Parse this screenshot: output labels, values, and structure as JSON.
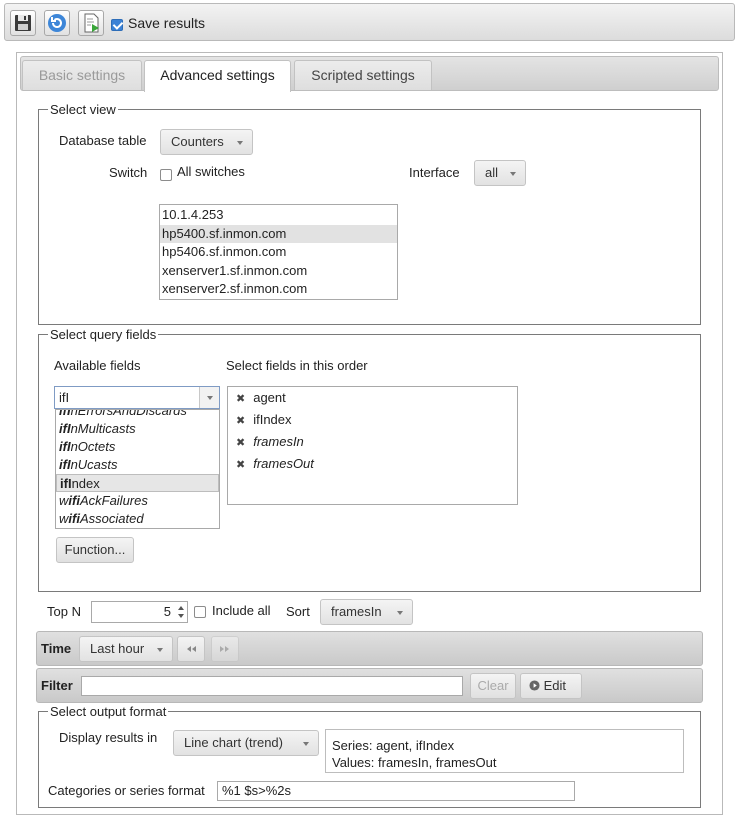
{
  "toolbar": {
    "save_icon": "floppy-disk-icon",
    "refresh_icon": "refresh-icon",
    "run_icon": "run-document-icon",
    "save_results_label": "Save results",
    "save_results_checked": true
  },
  "tabs": [
    {
      "label": "Basic settings",
      "active": false
    },
    {
      "label": "Advanced settings",
      "active": true
    },
    {
      "label": "Scripted settings",
      "active": false
    }
  ],
  "select_view": {
    "legend": "Select view",
    "database_table_label": "Database table",
    "database_table_value": "Counters",
    "switch_label": "Switch",
    "all_switches_label": "All switches",
    "interface_label": "Interface",
    "interface_value": "all",
    "switches": [
      "10.1.4.253",
      "hp5400.sf.inmon.com",
      "hp5406.sf.inmon.com",
      "xenserver1.sf.inmon.com",
      "xenserver2.sf.inmon.com"
    ],
    "selected_switch_index": 1
  },
  "query_fields": {
    "legend": "Select query fields",
    "available_label": "Available fields",
    "order_label": "Select fields in this order",
    "filter_value": "ifI",
    "available": [
      {
        "prefix": "",
        "match": "ifI",
        "suffix": "nErrorsAndDiscards"
      },
      {
        "prefix": "",
        "match": "ifI",
        "suffix": "nMulticasts"
      },
      {
        "prefix": "",
        "match": "ifI",
        "suffix": "nOctets"
      },
      {
        "prefix": "",
        "match": "ifI",
        "suffix": "nUcasts"
      },
      {
        "prefix": "",
        "match": "ifI",
        "suffix": "ndex"
      },
      {
        "prefix": "w",
        "match": "ifi",
        "suffix": "AckFailures"
      },
      {
        "prefix": "w",
        "match": "ifi",
        "suffix": "Associated"
      }
    ],
    "available_selected_index": 4,
    "selected": [
      {
        "name": "agent",
        "italic": false
      },
      {
        "name": "ifIndex",
        "italic": false
      },
      {
        "name": "framesIn",
        "italic": true
      },
      {
        "name": "framesOut",
        "italic": true
      }
    ],
    "function_button": "Function..."
  },
  "topn": {
    "label": "Top N",
    "value": "5",
    "include_all_label": "Include all",
    "sort_label": "Sort",
    "sort_value": "framesIn"
  },
  "time": {
    "label": "Time",
    "value": "Last hour",
    "prev_icon": "rewind-icon",
    "next_icon": "fast-forward-icon"
  },
  "filter": {
    "label": "Filter",
    "value": "",
    "clear_label": "Clear",
    "edit_label": "Edit"
  },
  "output": {
    "legend": "Select output format",
    "display_label": "Display results in",
    "display_value": "Line chart (trend)",
    "series_text": "Series: agent, ifIndex",
    "values_text": "Values: framesIn, framesOut",
    "format_label": "Categories or series format",
    "format_value": "%1 $s>%2s"
  }
}
